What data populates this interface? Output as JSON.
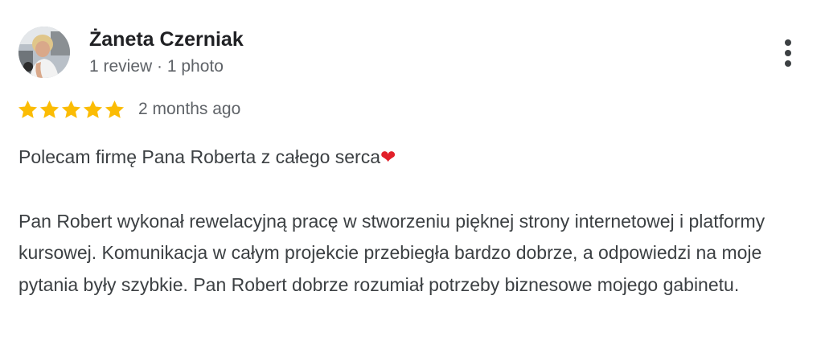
{
  "review": {
    "author": {
      "name": "Żaneta Czerniak",
      "meta": "1 review · 1 photo"
    },
    "rating": {
      "stars": 5,
      "max": 5,
      "star_color": "#fbbc04"
    },
    "time": "2 months ago",
    "text": {
      "line1": "Polecam firmę Pana Roberta z całego serca",
      "line1_emoji": "❤",
      "paragraph2": "Pan Robert wykonał rewelacyjną pracę w stworzeniu pięknej strony internetowej i platformy kursowej. Komunikacja w całym projekcie przebiegła bardzo dobrze, a odpowiedzi na moje pytania były szybkie. Pan Robert dobrze rozumiał potrzeby biznesowe mojego gabinetu."
    },
    "menu_icon": "more-vertical-icon"
  }
}
